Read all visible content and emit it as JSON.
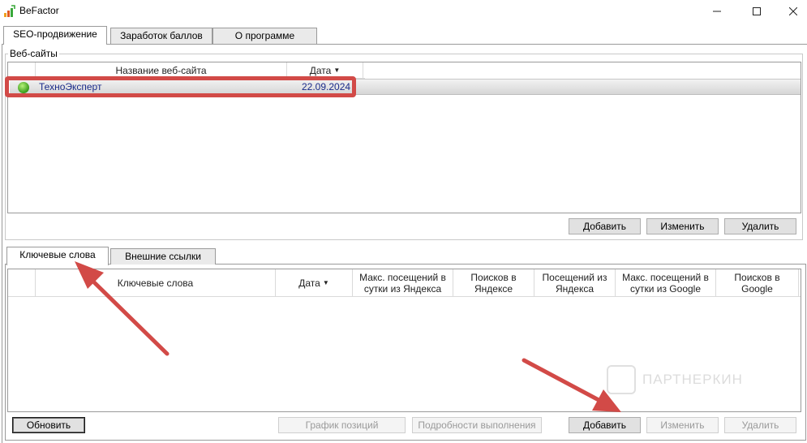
{
  "window": {
    "title": "BeFactor",
    "minimize_icon": "minimize-icon",
    "maximize_icon": "maximize-icon",
    "close_icon": "close-icon"
  },
  "main_tabs": [
    {
      "label": "SEO-продвижение",
      "active": true
    },
    {
      "label": "Заработок баллов",
      "active": false
    },
    {
      "label": "О программе",
      "active": false
    }
  ],
  "websites": {
    "group_title": "Веб-сайты",
    "columns": {
      "name": "Название веб-сайта",
      "date": "Дата"
    },
    "rows": [
      {
        "name": "ТехноЭксперт",
        "date": "22.09.2024",
        "status_icon": "green-status-icon"
      }
    ],
    "buttons": {
      "add": "Добавить",
      "edit": "Изменить",
      "delete": "Удалить"
    }
  },
  "sub_tabs": [
    {
      "label": "Ключевые слова",
      "active": true
    },
    {
      "label": "Внешние ссылки",
      "active": false
    }
  ],
  "keywords": {
    "columns": {
      "keywords": "Ключевые слова",
      "date": "Дата",
      "max_visits_yandex": "Макс. посещений в сутки из Яндекса",
      "searches_yandex": "Поисков в Яндексе",
      "visits_yandex": "Посещений из Яндекса",
      "max_visits_google": "Макс. посещений в сутки из Google",
      "searches_google": "Поисков в Google"
    },
    "buttons": {
      "refresh": "Обновить",
      "position_chart": "График позиций",
      "execution_details": "Подробности выполнения",
      "add": "Добавить",
      "edit": "Изменить",
      "delete": "Удалить"
    }
  },
  "watermark": {
    "text": "ПАРТНЕРКИН"
  },
  "colors": {
    "annotation_red": "#d24a47",
    "link_blue": "#1a2b8a",
    "status_green": "#3fa11f"
  }
}
